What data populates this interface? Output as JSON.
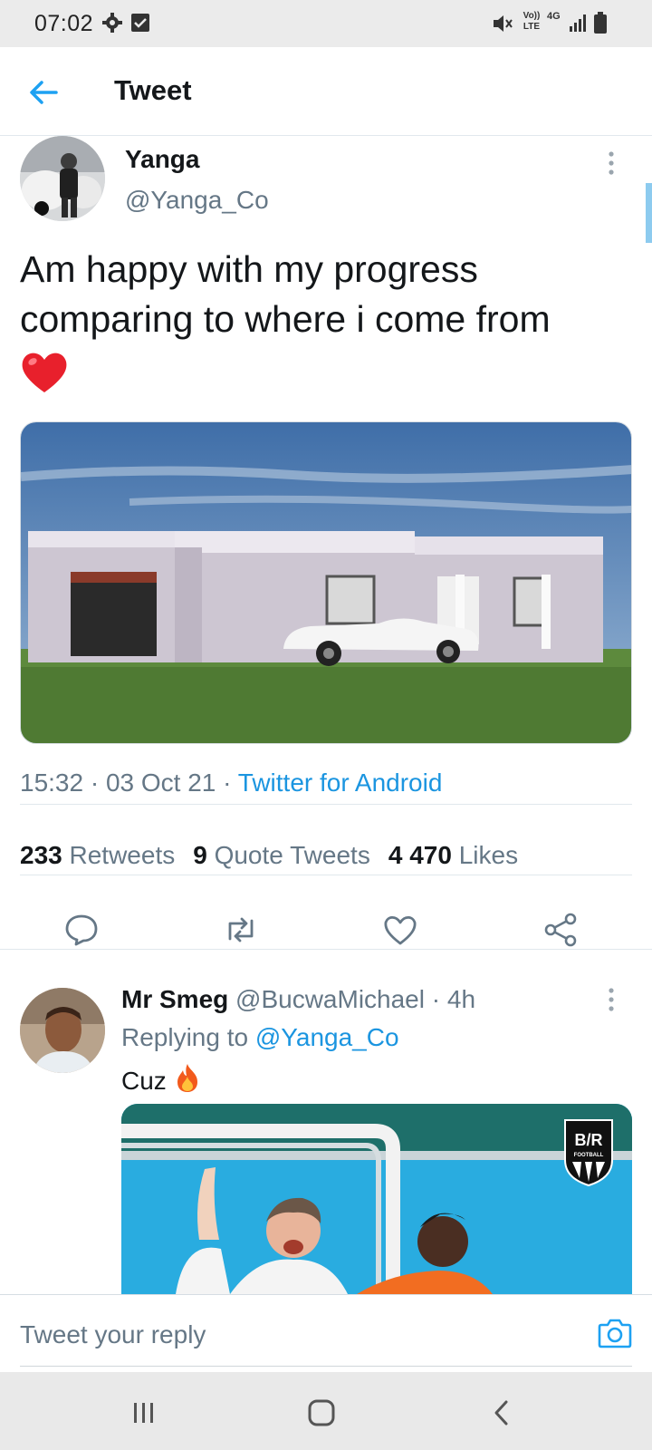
{
  "status_bar": {
    "time": "07:02",
    "icons": [
      "settings-icon",
      "checkbox-icon",
      "mute-icon",
      "volte-icon",
      "4g-icon",
      "signal-icon",
      "battery-icon"
    ],
    "volte_label": "Vo)) LTE",
    "network_label": "4G"
  },
  "app_bar": {
    "title": "Tweet",
    "back_icon": "arrow-left-icon"
  },
  "tweet": {
    "author_name": "Yanga",
    "author_handle": "@Yanga_Co",
    "text": "Am happy with my progress comparing to where i come from",
    "emoji": "red-heart",
    "time": "15:32",
    "separator": " · ",
    "date": "03 Oct 21",
    "source": "Twitter for Android",
    "retweets_count": "233",
    "retweets_label": "Retweets",
    "quotes_count": "9",
    "quotes_label": "Quote Tweets",
    "likes_count": "4 470",
    "likes_label": "Likes"
  },
  "actions": [
    "reply-icon",
    "retweet-icon",
    "like-icon",
    "share-icon"
  ],
  "reply": {
    "author_name": "Mr Smeg",
    "author_handle": "@BucwaMichael",
    "separator": " · ",
    "age": "4h",
    "replying_label": "Replying to",
    "replying_to": "@Yanga_Co",
    "text": "Cuz",
    "emoji": "fire",
    "media_badge_main": "B/R",
    "media_badge_sub": "FOOTBALL"
  },
  "compose": {
    "placeholder": "Tweet your reply",
    "camera_icon": "camera-icon"
  },
  "nav_bar": [
    "recents-icon",
    "home-icon",
    "back-icon"
  ],
  "colors": {
    "accent": "#1da1f2",
    "link": "#1b95e0",
    "muted": "#657786",
    "text": "#14171a"
  }
}
